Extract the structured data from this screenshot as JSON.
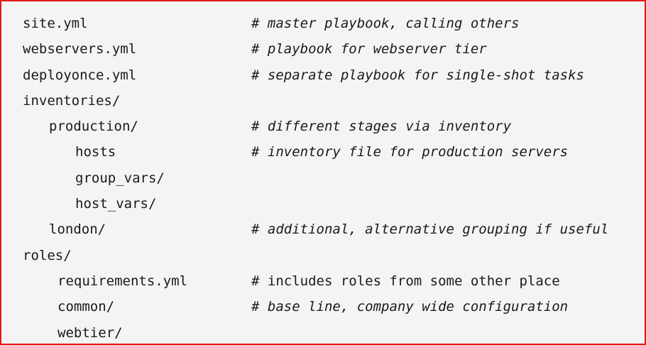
{
  "lines": [
    {
      "path": "site.yml",
      "comment": "# master playbook, calling others"
    },
    {
      "path": "webservers.yml",
      "comment": "# playbook for webserver tier"
    },
    {
      "path": "deployonce.yml",
      "comment": "# separate playbook for single-shot tasks"
    },
    {
      "path": "inventories/",
      "comment": ""
    },
    {
      "path": "production/",
      "comment": "# different stages via inventory"
    },
    {
      "path": "hosts",
      "comment": "# inventory file for production servers"
    },
    {
      "path": "group_vars/",
      "comment": ""
    },
    {
      "path": "host_vars/",
      "comment": ""
    },
    {
      "path": "london/",
      "comment": "# additional, alternative grouping if useful"
    },
    {
      "path": "roles/",
      "comment": ""
    },
    {
      "path": "requirements.yml",
      "comment": "# includes roles from some other place"
    },
    {
      "path": "common/",
      "comment": "# base line, company wide configuration"
    },
    {
      "path": "webtier/",
      "comment": ""
    }
  ]
}
